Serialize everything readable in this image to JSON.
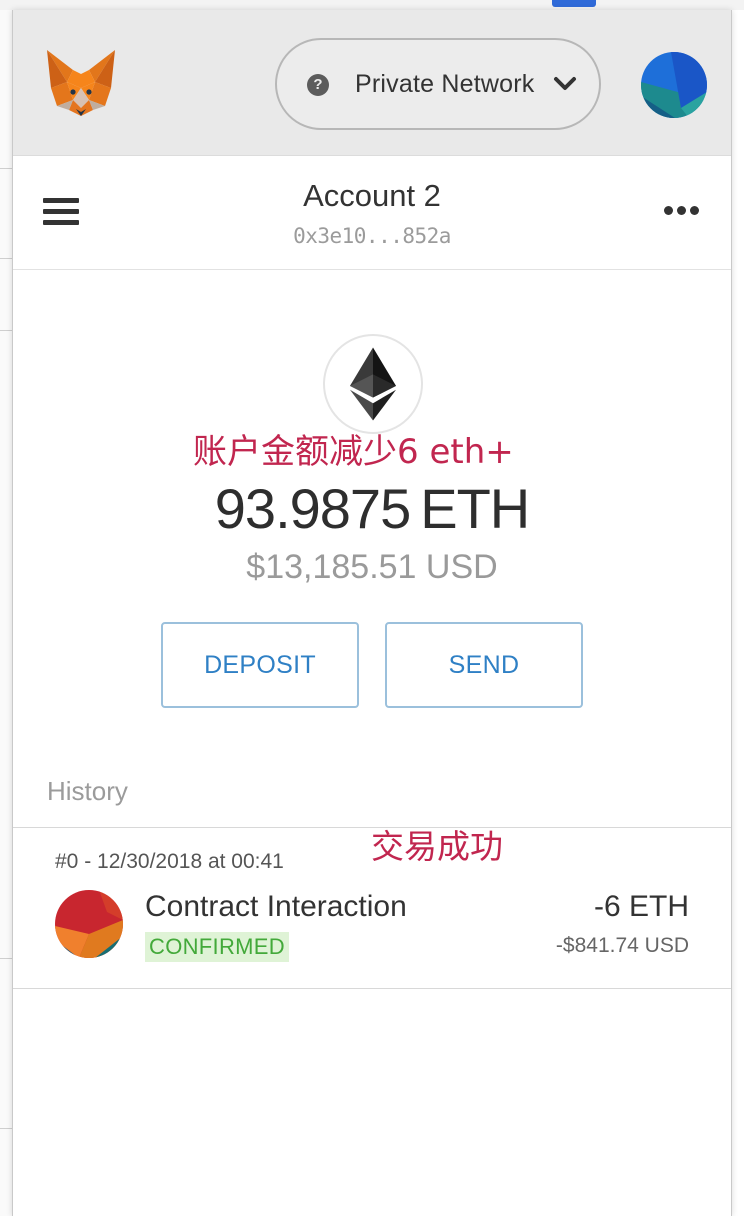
{
  "header": {
    "network": {
      "label": "Private Network",
      "help_icon": "question-circle-icon",
      "chevron_icon": "chevron-down-icon"
    },
    "logo_icon": "metamask-fox-icon",
    "avatar_icon": "account-identicon"
  },
  "account": {
    "name": "Account 2",
    "address": "0x3e10...852a",
    "menu_icon": "hamburger-menu-icon",
    "more_icon": "more-options-icon"
  },
  "balance": {
    "eth_icon": "ethereum-logo-icon",
    "amount": "93.9875",
    "unit": "ETH",
    "fiat": "$13,185.51 USD"
  },
  "actions": {
    "deposit": "DEPOSIT",
    "send": "SEND"
  },
  "history": {
    "heading": "History",
    "transactions": [
      {
        "meta": "#0 - 12/30/2018 at 00:41",
        "title": "Contract Interaction",
        "status": "CONFIRMED",
        "amount": "-6 ETH",
        "fiat": "-$841.74 USD"
      }
    ]
  },
  "annotations": {
    "balance_note": "账户金额减少6 eth+",
    "tx_note": "交易成功"
  },
  "colors": {
    "accent_blue": "#2f80c5",
    "status_green": "#43a93a",
    "annotation_red": "#c1264f"
  }
}
